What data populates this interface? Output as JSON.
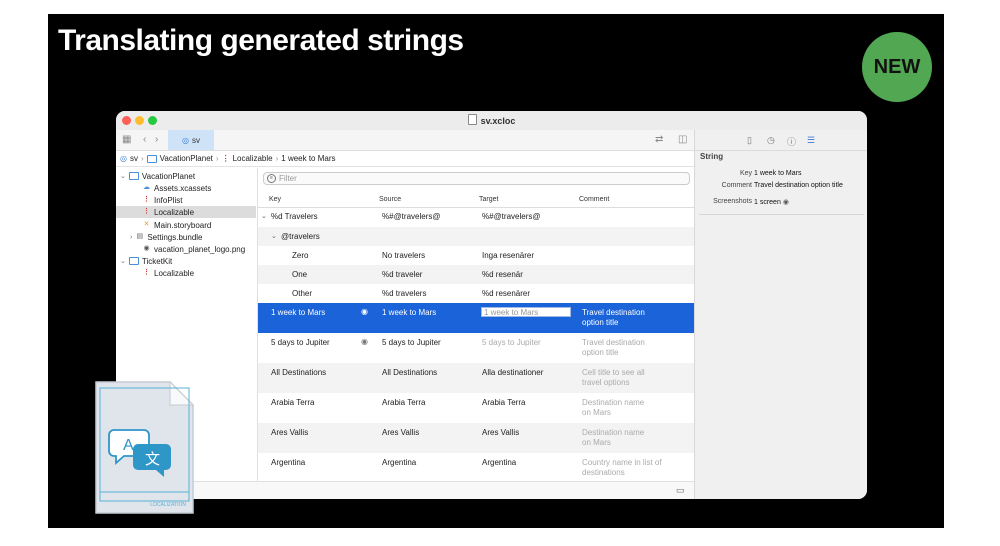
{
  "slide": {
    "title": "Translating generated strings",
    "badge": "NEW"
  },
  "window": {
    "title": "sv.xcloc"
  },
  "toolbar": {
    "tab_label": "sv"
  },
  "breadcrumbs": [
    "sv",
    "VacationPlanet",
    "Localizable",
    "1 week to Mars"
  ],
  "navigator": {
    "items": [
      {
        "label": "VacationPlanet",
        "icon": "folder-icon"
      },
      {
        "label": "Assets.xcassets",
        "icon": "asset-catalog-icon"
      },
      {
        "label": "InfoPlist",
        "icon": "strings-file-icon"
      },
      {
        "label": "Localizable",
        "icon": "strings-file-icon"
      },
      {
        "label": "Main.storyboard",
        "icon": "storyboard-icon"
      },
      {
        "label": "Settings.bundle",
        "icon": "bundle-icon"
      },
      {
        "label": "vacation_planet_logo.png",
        "icon": "image-file-icon"
      },
      {
        "label": "TicketKit",
        "icon": "folder-icon"
      },
      {
        "label": "Localizable",
        "icon": "strings-file-icon"
      }
    ],
    "selected": "Localizable"
  },
  "filter": {
    "placeholder": "Filter"
  },
  "table": {
    "columns": [
      "Key",
      "Source",
      "Target",
      "Comment"
    ],
    "rows": [
      {
        "key": "%d Travelers",
        "source": "%#@travelers@",
        "target": "%#@travelers@",
        "comment": ""
      },
      {
        "key": "@travelers",
        "source": "",
        "target": "",
        "comment": ""
      },
      {
        "key": "Zero",
        "source": "No travelers",
        "target": "Inga resenärer",
        "comment": ""
      },
      {
        "key": "One",
        "source": "%d traveler",
        "target": "%d resenär",
        "comment": ""
      },
      {
        "key": "Other",
        "source": "%d travelers",
        "target": "%d resenärer",
        "comment": ""
      },
      {
        "key": "1 week to Mars",
        "source": "1 week to Mars",
        "target": "1 week to Mars",
        "comment": "Travel destination\noption title"
      },
      {
        "key": "5 days to Jupiter",
        "source": "5 days to Jupiter",
        "target": "5 days to Jupiter",
        "comment": "Travel destination\noption title"
      },
      {
        "key": "All Destinations",
        "source": "All Destinations",
        "target": "Alla destinationer",
        "comment": "Cell title to see all\ntravel options"
      },
      {
        "key": "Arabia Terra",
        "source": "Arabia Terra",
        "target": "Arabia Terra",
        "comment": "Destination name\non Mars"
      },
      {
        "key": "Ares Vallis",
        "source": "Ares Vallis",
        "target": "Ares Vallis",
        "comment": "Destination name\non Mars"
      },
      {
        "key": "Argentina",
        "source": "Argentina",
        "target": "Argentina",
        "comment": "Country name in list of\ndestinations"
      }
    ]
  },
  "inspector": {
    "heading": "String",
    "key_label": "Key",
    "key_value": "1 week to Mars",
    "comment_label": "Comment",
    "comment_value": "Travel destination option title",
    "screenshots_label": "Screenshots",
    "screenshots_value": "1 screen"
  },
  "document_icon": {
    "glyph_latin": "A",
    "glyph_cjk": "文",
    "caption": "LOCALIZATION"
  },
  "colors": {
    "selection": "#1a63d8",
    "badge": "#52a852",
    "accent_blue": "#4a90d9"
  }
}
